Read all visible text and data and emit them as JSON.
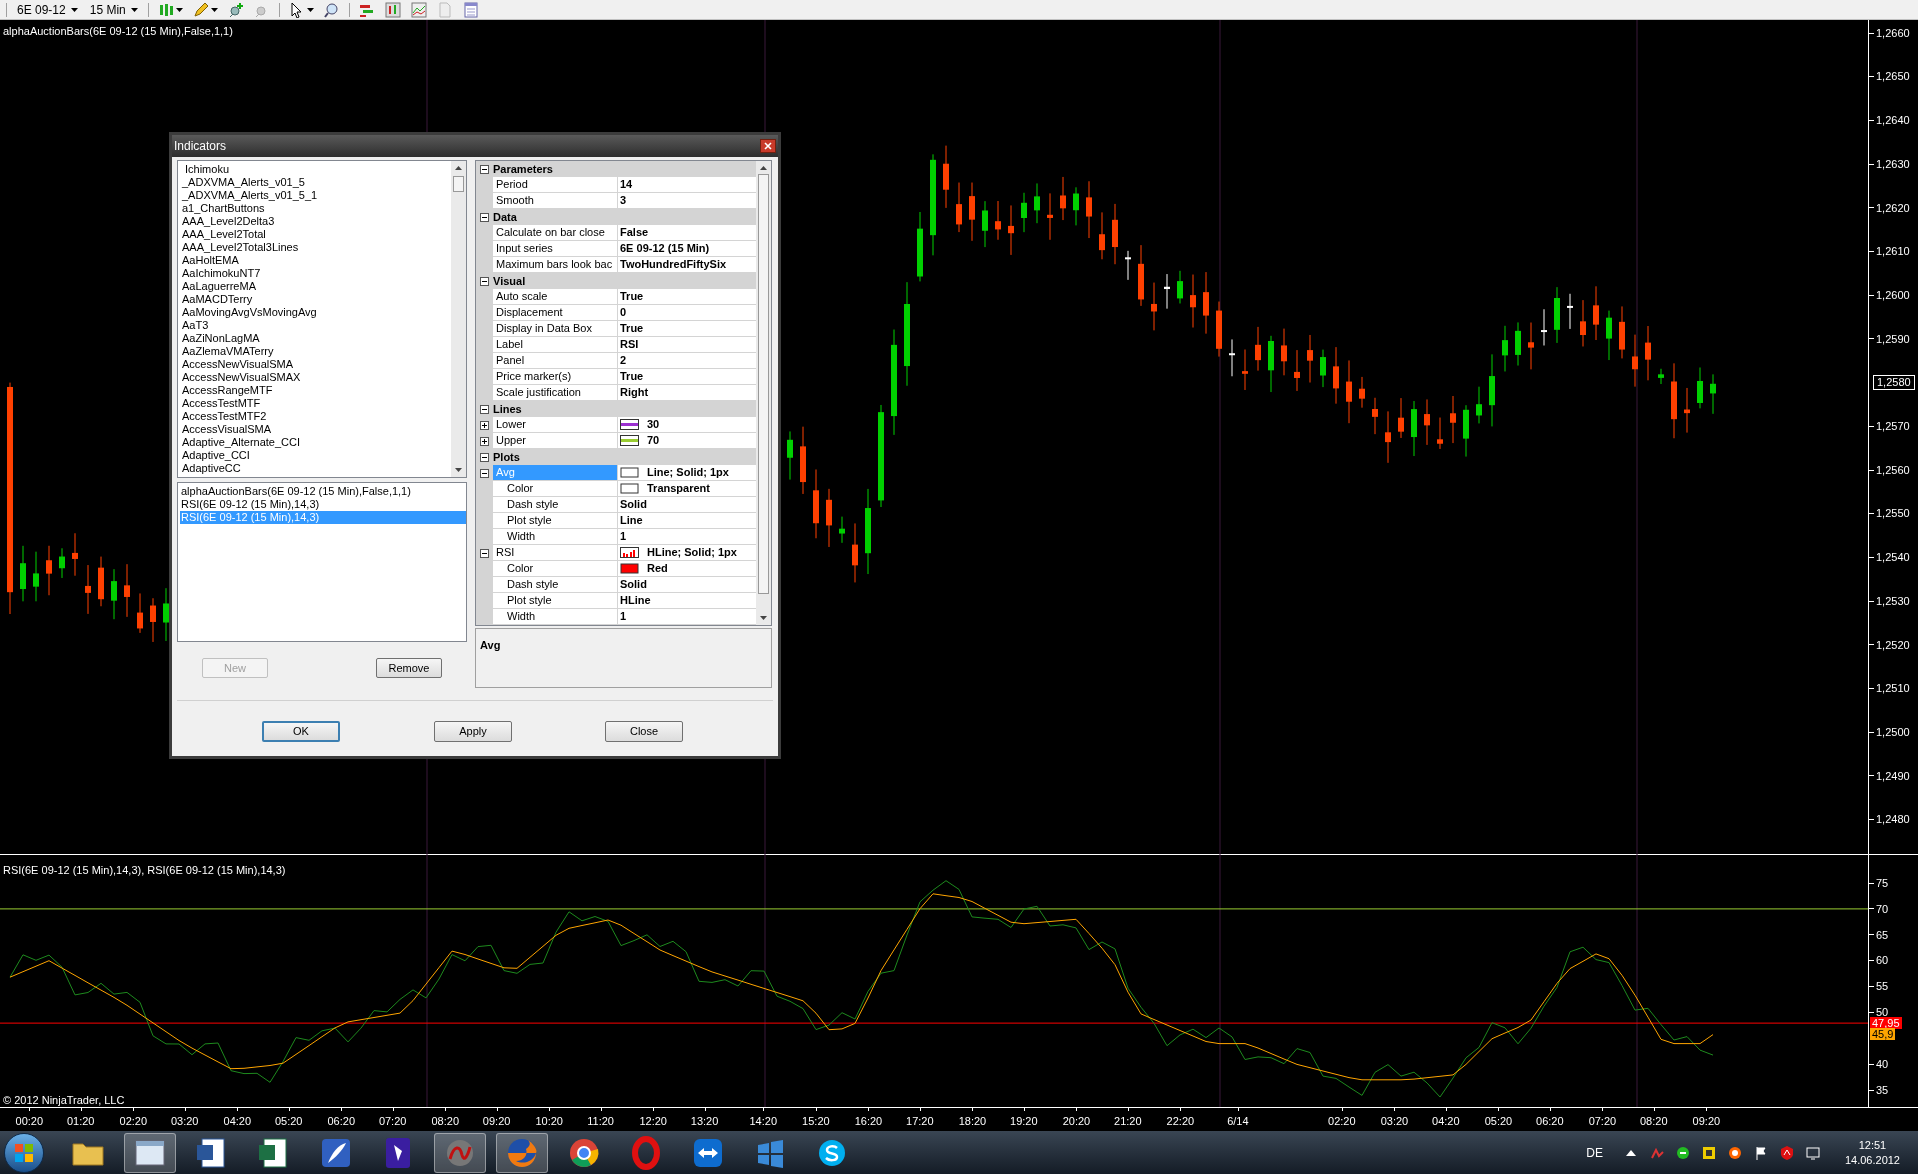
{
  "toolbar": {
    "instrument": "6E 09-12",
    "interval": "15 Min"
  },
  "chart": {
    "title": "alphaAuctionBars(6E 09-12 (15 Min),False,1,1)",
    "price_labels": [
      "1,2660",
      "1,2650",
      "1,2640",
      "1,2630",
      "1,2620",
      "1,2610",
      "1,2600",
      "1,2590"
    ],
    "price_labels_lower": [
      "1,2570",
      "1,2560",
      "1,2550",
      "1,2540",
      "1,2530",
      "1,2520",
      "1,2510",
      "1,2500",
      "1,2490",
      "1,2480"
    ],
    "current_price": "1,2580"
  },
  "rsi_panel": {
    "title": "RSI(6E 09-12 (15 Min),14,3), RSI(6E 09-12 (15 Min),14,3)",
    "labels": [
      "75",
      "70",
      "65",
      "60",
      "55",
      "50"
    ],
    "labels_lower": [
      "40",
      "35"
    ],
    "markers": [
      {
        "text": "47,95",
        "color": "#ff0000"
      },
      {
        "text": "45,9",
        "color": "#ffa500"
      }
    ],
    "copyright": "© 2012 NinjaTrader, LLC"
  },
  "time_axis": [
    "00:20",
    "01:20",
    "02:20",
    "03:20",
    "04:20",
    "05:20",
    "06:20",
    "07:20",
    "08:20",
    "09:20",
    "10:20",
    "11:20",
    "12:20",
    "13:20",
    "14:20",
    "15:20",
    "16:20",
    "17:20",
    "18:20",
    "19:20",
    "20:20",
    "21:20",
    "22:20",
    "6/14",
    "02:20",
    "03:20",
    "04:20",
    "05:20",
    "06:20",
    "07:20",
    "08:20",
    "09:20"
  ],
  "dialog": {
    "title": "Indicators",
    "available": [
      "Ichimoku",
      "_ADXVMA_Alerts_v01_5",
      "_ADXVMA_Alerts_v01_5_1",
      "a1_ChartButtons",
      "AAA_Level2Delta3",
      "AAA_Level2Total",
      "AAA_Level2Total3Lines",
      "AaHoltEMA",
      "AaIchimokuNT7",
      "AaLaguerreMA",
      "AaMACDTerry",
      "AaMovingAvgVsMovingAvg",
      "AaT3",
      "AaZiNonLagMA",
      "AaZlemaVMATerry",
      "AccessNewVisualSMA",
      "AccessNewVisualSMAX",
      "AccessRangeMTF",
      "AccessTestMTF",
      "AccessTestMTF2",
      "AccessVisualSMA",
      "Adaptive_Alternate_CCI",
      "Adaptive_CCI",
      "AdaptiveCC"
    ],
    "applied": [
      {
        "label": "alphaAuctionBars(6E 09-12 (15 Min),False,1,1)",
        "selected": false
      },
      {
        "label": "RSI(6E 09-12 (15 Min),14,3)",
        "selected": false
      },
      {
        "label": "RSI(6E 09-12 (15 Min),14,3)",
        "selected": true
      }
    ],
    "list_buttons": [
      {
        "label": "New",
        "disabled": true
      },
      {
        "label": "Remove",
        "disabled": false
      }
    ],
    "property_grid": [
      {
        "category": "Parameters",
        "expanded": true,
        "rows": [
          {
            "name": "Period",
            "value": "14",
            "selected": false
          },
          {
            "name": "Smooth",
            "value": "3",
            "selected": false
          }
        ]
      },
      {
        "category": "Data",
        "expanded": true,
        "rows": [
          {
            "name": "Calculate on bar close",
            "value": "False",
            "selected": false
          },
          {
            "name": "Input series",
            "value": "6E 09-12 (15 Min)",
            "selected": false
          },
          {
            "name": "Maximum bars look bac",
            "value": "TwoHundredFiftySix",
            "selected": false
          }
        ]
      },
      {
        "category": "Visual",
        "expanded": true,
        "rows": [
          {
            "name": "Auto scale",
            "value": "True",
            "selected": false
          },
          {
            "name": "Displacement",
            "value": "0",
            "selected": false
          },
          {
            "name": "Display in Data Box",
            "value": "True",
            "selected": false
          },
          {
            "name": "Label",
            "value": "RSI",
            "selected": false
          },
          {
            "name": "Panel",
            "value": "2",
            "selected": false
          },
          {
            "name": "Price marker(s)",
            "value": "True",
            "selected": false
          },
          {
            "name": "Scale justification",
            "value": "Right",
            "selected": false
          }
        ]
      },
      {
        "category": "Lines",
        "expanded": true,
        "rows": [
          {
            "name": "Lower",
            "value": "30",
            "selected": false,
            "expanded": false,
            "swatch": {
              "kind": "line",
              "color": "#9b30d0"
            }
          },
          {
            "name": "Upper",
            "value": "70",
            "selected": false,
            "expanded": false,
            "swatch": {
              "kind": "line",
              "color": "#9acd32"
            }
          }
        ]
      },
      {
        "category": "Plots",
        "expanded": true,
        "rows": [
          {
            "name": "Avg",
            "value": "Line; Solid; 1px",
            "selected": true,
            "expanded": true,
            "swatch": {
              "kind": "box",
              "color": "#ffffff"
            },
            "children": [
              {
                "name": "Color",
                "value": "Transparent",
                "selected": false,
                "swatch": {
                  "kind": "box",
                  "color": "#ffffff"
                }
              },
              {
                "name": "Dash style",
                "value": "Solid",
                "selected": false
              },
              {
                "name": "Plot style",
                "value": "Line",
                "selected": false
              },
              {
                "name": "Width",
                "value": "1",
                "selected": false
              }
            ]
          },
          {
            "name": "RSI",
            "value": "HLine; Solid; 1px",
            "selected": false,
            "expanded": true,
            "swatch": {
              "kind": "bars",
              "color": "#ff0000"
            },
            "children": [
              {
                "name": "Color",
                "value": "Red",
                "selected": false,
                "swatch": {
                  "kind": "box",
                  "color": "#ff0000"
                }
              },
              {
                "name": "Dash style",
                "value": "Solid",
                "selected": false
              },
              {
                "name": "Plot style",
                "value": "HLine",
                "selected": false
              },
              {
                "name": "Width",
                "value": "1",
                "selected": false
              }
            ]
          }
        ]
      }
    ],
    "description": "Avg",
    "buttons": [
      "OK",
      "Apply",
      "Close"
    ]
  },
  "taskbar": {
    "apps": [
      {
        "kind": "folder",
        "active": false
      },
      {
        "kind": "window",
        "active": true
      },
      {
        "kind": "word",
        "active": false
      },
      {
        "kind": "excel",
        "active": false
      },
      {
        "kind": "feather",
        "active": false
      },
      {
        "kind": "paint",
        "active": false
      },
      {
        "kind": "ninja",
        "active": true
      },
      {
        "kind": "firefox",
        "active": true
      },
      {
        "kind": "chrome",
        "active": false
      },
      {
        "kind": "opera",
        "active": false
      },
      {
        "kind": "teamviewer",
        "active": false
      },
      {
        "kind": "windows",
        "active": false
      },
      {
        "kind": "skype",
        "active": false
      }
    ],
    "language": "DE",
    "time": "12:51",
    "date": "14.06.2012"
  }
}
